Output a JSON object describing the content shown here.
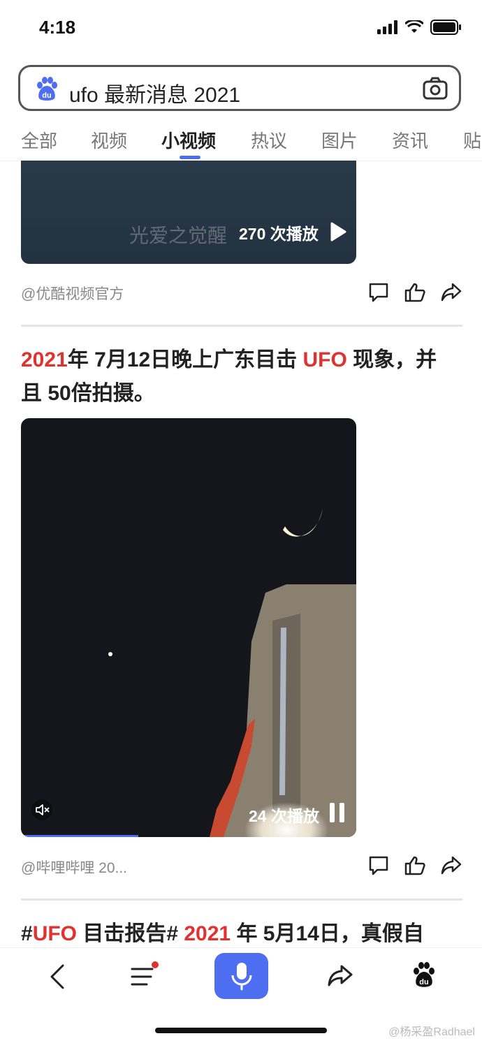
{
  "status": {
    "time": "4:18"
  },
  "search": {
    "query": "ufo 最新消息 2021"
  },
  "tabs": [
    "全部",
    "视频",
    "小视频",
    "热议",
    "图片",
    "资讯",
    "贴"
  ],
  "feed": [
    {
      "watermark": "光爱之觉醒",
      "plays": "270 次播放",
      "source": "@优酷视频官方"
    },
    {
      "title_parts": [
        "2021",
        "年 7月12日晚上广东目击 ",
        "UFO",
        " 现象，并",
        "且 50倍拍摄。"
      ],
      "plays": "24 次播放",
      "source": "@哔哩哔哩 20...",
      "progress": 0.35
    },
    {
      "title_parts": [
        "#",
        "UFO",
        " 目击报告# ",
        "2021",
        " 年 5月14日，真假自"
      ]
    }
  ],
  "credit": "@杨采盈Radhael",
  "colors": {
    "accent": "#4e6ef2",
    "highlight": "#e0322f"
  }
}
